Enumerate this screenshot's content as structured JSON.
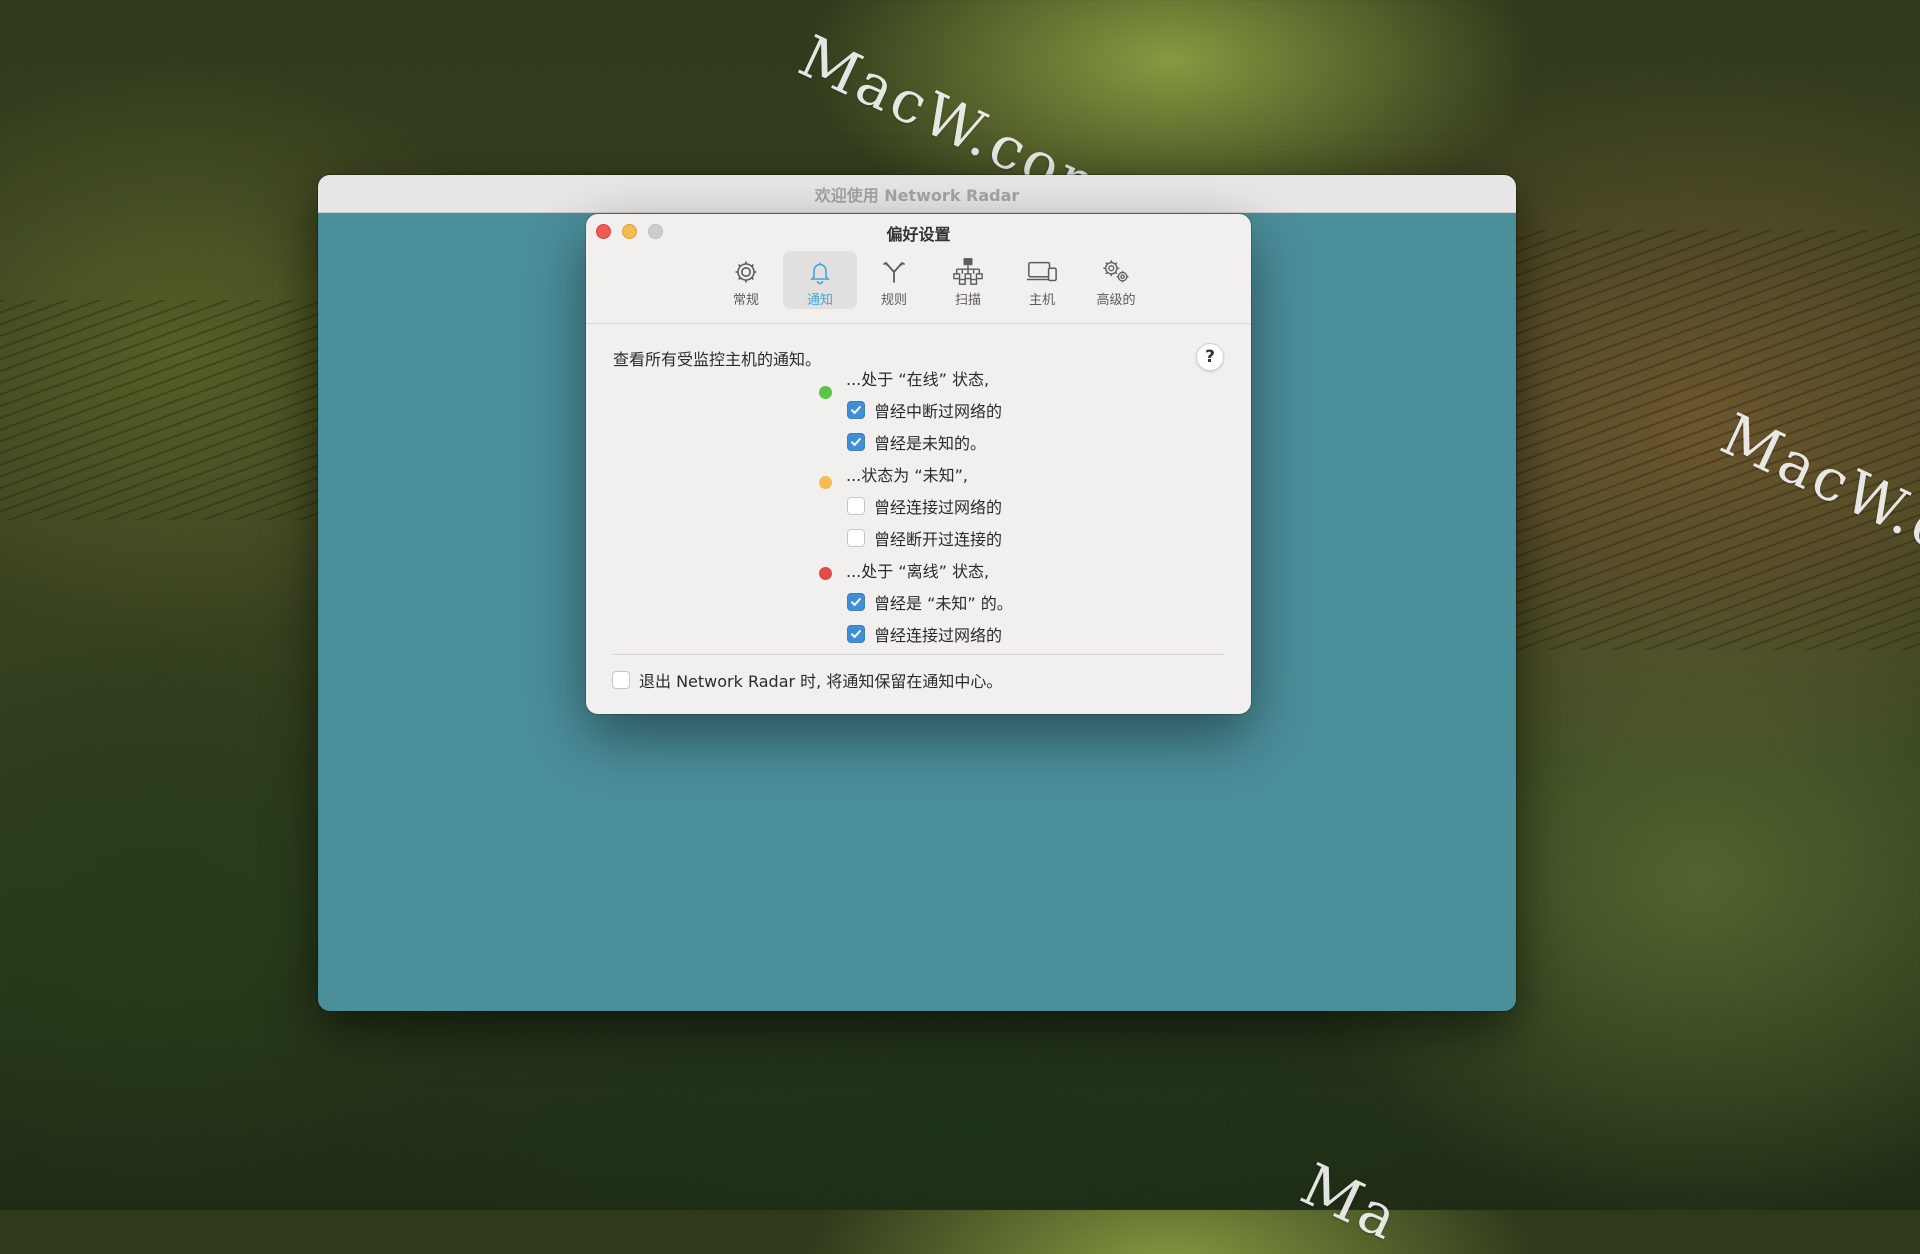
{
  "desktop": {
    "watermark_text": "MacW.com",
    "watermark_partial_text": "Ma"
  },
  "main_window": {
    "title": "欢迎使用 Network Radar",
    "content_color": "#4b8f9b"
  },
  "preferences": {
    "title": "偏好设置",
    "toolbar": [
      {
        "label": "常规",
        "icon": "gear-icon",
        "active": false
      },
      {
        "label": "通知",
        "icon": "bell-icon",
        "active": true
      },
      {
        "label": "规则",
        "icon": "branch-icon",
        "active": false
      },
      {
        "label": "扫描",
        "icon": "network-tree-icon",
        "active": false
      },
      {
        "label": "主机",
        "icon": "devices-icon",
        "active": false
      },
      {
        "label": "高级的",
        "icon": "gears-icon",
        "active": false
      }
    ],
    "intro": "查看所有受监控主机的通知。",
    "help_label": "?",
    "groups": [
      {
        "status_color": "#5cc24a",
        "heading": "...处于 “在线” 状态,",
        "options": [
          {
            "label": "曾经中断过网络的",
            "checked": true
          },
          {
            "label": "曾经是未知的。",
            "checked": true
          }
        ]
      },
      {
        "status_color": "#f4bd4f",
        "heading": "...状态为 “未知”,",
        "options": [
          {
            "label": "曾经连接过网络的",
            "checked": false
          },
          {
            "label": "曾经断开过连接的",
            "checked": false
          }
        ]
      },
      {
        "status_color": "#e24b45",
        "heading": "...处于 “离线” 状态,",
        "options": [
          {
            "label": "曾经是 “未知” 的。",
            "checked": true
          },
          {
            "label": "曾经连接过网络的",
            "checked": true
          }
        ]
      }
    ],
    "footer_option": {
      "label": "退出 Network Radar 时, 将通知保留在通知中心。",
      "checked": false
    },
    "accent_color": "#3e8fd6"
  }
}
